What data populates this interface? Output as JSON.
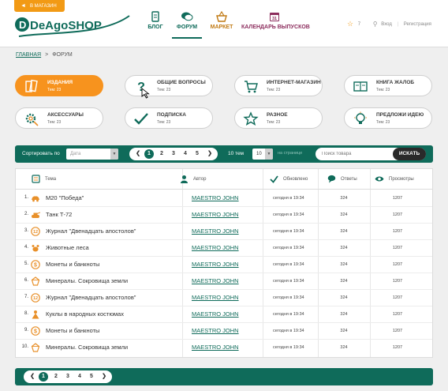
{
  "header": {
    "store_tag": "В МАГАЗИН",
    "logo_text": "DeAgoSHOP",
    "nav": {
      "blog": "БЛОГ",
      "forum": "ФОРУМ",
      "market": "МАРКЕТ",
      "calendar": "КАЛЕНДАРЬ ВЫПУСКОВ",
      "calendar_day": "31"
    },
    "favorites_count": "7",
    "login": "Вход",
    "register": "Регистрация"
  },
  "breadcrumb": {
    "home": "ГЛАВНАЯ",
    "separator": ">",
    "current": "ФОРУМ"
  },
  "categories": [
    {
      "title": "ИЗДАНИЯ",
      "subtitle": "Тем: 23",
      "icon": "books-icon",
      "active": true
    },
    {
      "title": "ОБЩИЕ ВОПРОСЫ",
      "subtitle": "Тем: 23",
      "icon": "question-icon",
      "active": false
    },
    {
      "title": "ИНТЕРНЕТ-МАГАЗИН",
      "subtitle": "Тем: 23",
      "icon": "cart-icon",
      "active": false
    },
    {
      "title": "КНИГА ЖАЛОБ",
      "subtitle": "Тем: 23",
      "icon": "open-book-icon",
      "active": false
    },
    {
      "title": "АКСЕССУАРЫ",
      "subtitle": "Тем: 23",
      "icon": "gear-icon",
      "active": false
    },
    {
      "title": "ПОДПИСКА",
      "subtitle": "Тем: 23",
      "icon": "checkmark-icon",
      "active": false
    },
    {
      "title": "РАЗНОЕ",
      "subtitle": "Тем: 23",
      "icon": "star-icon",
      "active": false
    },
    {
      "title": "ПРЕДЛОЖИ ИДЕЮ",
      "subtitle": "Тем: 23",
      "icon": "lightbulb-icon",
      "active": false
    }
  ],
  "toolbar": {
    "sort_label": "Сортировать по",
    "sort_value": "Дата",
    "pages": [
      "1",
      "2",
      "3",
      "4",
      "5"
    ],
    "current_page": "1",
    "per_page_label": "10 тем",
    "per_page_value": "10",
    "on_page_label": "на странице",
    "search_placeholder": "Поиск товара",
    "search_button": "ИСКАТЬ"
  },
  "table": {
    "columns": {
      "topic": "Тема",
      "author": "Автор",
      "updated": "Обновлено",
      "answers": "Ответы",
      "views": "Просмотры"
    },
    "rows": [
      {
        "num": "1.",
        "topic": "М20 \"Победа\"",
        "author": "MAESTRO JOHN",
        "updated": "сегодня в 19:34",
        "answers": "324",
        "views": "1207",
        "icon": "car-icon"
      },
      {
        "num": "2.",
        "topic": "Танк Т-72",
        "author": "MAESTRO JOHN",
        "updated": "сегодня в 19:34",
        "answers": "324",
        "views": "1207",
        "icon": "tank-icon"
      },
      {
        "num": "3.",
        "topic": "Журнал \"Двенадцать апостолов\"",
        "author": "MAESTRO JOHN",
        "updated": "сегодня в 19:34",
        "answers": "324",
        "views": "1207",
        "icon": "twelve-badge-icon"
      },
      {
        "num": "4.",
        "topic": "Животные леса",
        "author": "MAESTRO JOHN",
        "updated": "сегодня в 19:34",
        "answers": "324",
        "views": "1207",
        "icon": "animal-icon"
      },
      {
        "num": "5.",
        "topic": "Монеты и банкноты",
        "author": "MAESTRO JOHN",
        "updated": "сегодня в 19:34",
        "answers": "324",
        "views": "1207",
        "icon": "coin-icon"
      },
      {
        "num": "6.",
        "topic": "Минералы. Сокровища земли",
        "author": "MAESTRO JOHN",
        "updated": "сегодня в 19:34",
        "answers": "324",
        "views": "1207",
        "icon": "mineral-icon"
      },
      {
        "num": "7.",
        "topic": "Журнал \"Двенадцать апостолов\"",
        "author": "MAESTRO JOHN",
        "updated": "сегодня в 19:34",
        "answers": "324",
        "views": "1207",
        "icon": "twelve-badge-icon"
      },
      {
        "num": "8.",
        "topic": "Куклы в народных костюмах",
        "author": "MAESTRO JOHN",
        "updated": "сегодня в 19:34",
        "answers": "324",
        "views": "1207",
        "icon": "doll-icon"
      },
      {
        "num": "9.",
        "topic": "Монеты и банкноты",
        "author": "MAESTRO JOHN",
        "updated": "сегодня в 19:34",
        "answers": "324",
        "views": "1207",
        "icon": "coin-icon"
      },
      {
        "num": "10.",
        "topic": "Минералы. Сокровища земли",
        "author": "MAESTRO JOHN",
        "updated": "сегодня в 19:34",
        "answers": "324",
        "views": "1207",
        "icon": "mineral-icon"
      }
    ]
  },
  "bottom_pager": {
    "pages": [
      "1",
      "2",
      "3",
      "4",
      "5"
    ],
    "current_page": "1"
  },
  "colors": {
    "brand_green": "#0f6b5a",
    "accent_orange": "#f7931e",
    "market_orange": "#c17a14",
    "calendar_purple": "#8c2d5d",
    "icon_orange": "#e8902a"
  }
}
